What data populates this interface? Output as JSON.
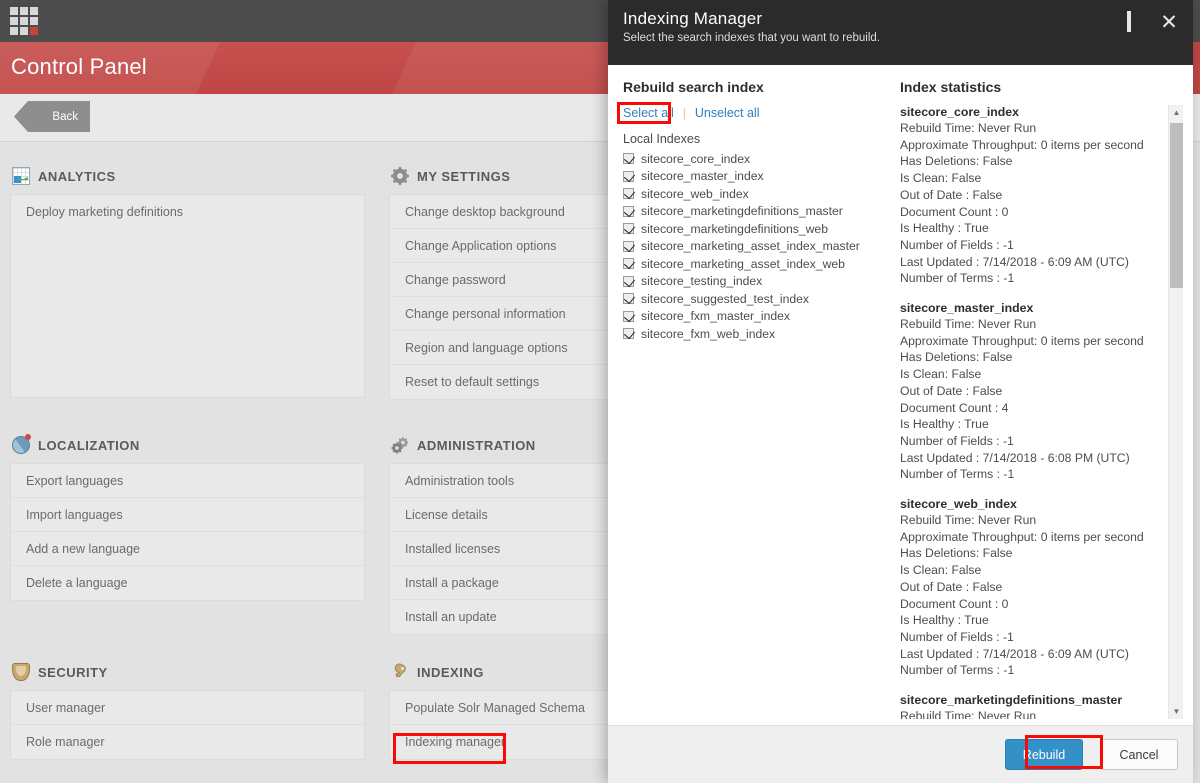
{
  "app": {
    "logo_name": "sitecore-grid-logo",
    "banner_title": "Control Panel",
    "back_label": "Back",
    "accent_red": "#bf4644",
    "topbar_bg": "#4c4c4c"
  },
  "control_panel": {
    "sections": [
      {
        "id": "analytics",
        "title": "ANALYTICS",
        "icon": "analytics-chart-icon",
        "column": 1,
        "items": [
          "Deploy marketing definitions"
        ]
      },
      {
        "id": "my-settings",
        "title": "MY SETTINGS",
        "icon": "gear-icon",
        "column": 2,
        "items": [
          "Change desktop background",
          "Change Application options",
          "Change password",
          "Change personal information",
          "Region and language options",
          "Reset to default settings"
        ]
      },
      {
        "id": "localization",
        "title": "LOCALIZATION",
        "icon": "globe-pin-icon",
        "column": 1,
        "items": [
          "Export languages",
          "Import languages",
          "Add a new language",
          "Delete a language"
        ]
      },
      {
        "id": "administration",
        "title": "ADMINISTRATION",
        "icon": "gears-icon",
        "column": 2,
        "items": [
          "Administration tools",
          "License details",
          "Installed licenses",
          "Install a package",
          "Install an update"
        ]
      },
      {
        "id": "security",
        "title": "SECURITY",
        "icon": "shield-icon",
        "column": 1,
        "items": [
          "User manager",
          "Role manager"
        ]
      },
      {
        "id": "indexing",
        "title": "INDEXING",
        "icon": "key-icon",
        "column": 2,
        "items": [
          "Populate Solr Managed Schema",
          "Indexing manager"
        ],
        "highlighted_item": "Indexing manager"
      }
    ]
  },
  "dialog": {
    "title": "Indexing Manager",
    "subtitle": "Select the search indexes that you want to rebuild.",
    "window_controls": {
      "maximize": "maximize-icon",
      "close": "close-icon"
    },
    "left": {
      "heading": "Rebuild search index",
      "select_all": "Select all",
      "unselect_all": "Unselect all",
      "separator": "|",
      "group_label": "Local Indexes",
      "indexes": [
        {
          "name": "sitecore_core_index",
          "checked": true
        },
        {
          "name": "sitecore_master_index",
          "checked": true
        },
        {
          "name": "sitecore_web_index",
          "checked": true
        },
        {
          "name": "sitecore_marketingdefinitions_master",
          "checked": true
        },
        {
          "name": "sitecore_marketingdefinitions_web",
          "checked": true
        },
        {
          "name": "sitecore_marketing_asset_index_master",
          "checked": true
        },
        {
          "name": "sitecore_marketing_asset_index_web",
          "checked": true
        },
        {
          "name": "sitecore_testing_index",
          "checked": true
        },
        {
          "name": "sitecore_suggested_test_index",
          "checked": true
        },
        {
          "name": "sitecore_fxm_master_index",
          "checked": true
        },
        {
          "name": "sitecore_fxm_web_index",
          "checked": true
        }
      ]
    },
    "right": {
      "heading": "Index statistics",
      "blocks": [
        {
          "name": "sitecore_core_index",
          "lines": [
            "Rebuild Time: Never Run",
            "Approximate Throughput: 0 items per second",
            "Has Deletions: False",
            "Is Clean: False",
            "Out of Date : False",
            "Document Count : 0",
            "Is Healthy : True",
            "Number of Fields : -1",
            "Last Updated : 7/14/2018 - 6:09 AM (UTC)",
            "Number of Terms : -1"
          ]
        },
        {
          "name": "sitecore_master_index",
          "lines": [
            "Rebuild Time: Never Run",
            "Approximate Throughput: 0 items per second",
            "Has Deletions: False",
            "Is Clean: False",
            "Out of Date : False",
            "Document Count : 4",
            "Is Healthy : True",
            "Number of Fields : -1",
            "Last Updated : 7/14/2018 - 6:08 PM (UTC)",
            "Number of Terms : -1"
          ]
        },
        {
          "name": "sitecore_web_index",
          "lines": [
            "Rebuild Time: Never Run",
            "Approximate Throughput: 0 items per second",
            "Has Deletions: False",
            "Is Clean: False",
            "Out of Date : False",
            "Document Count : 0",
            "Is Healthy : True",
            "Number of Fields : -1",
            "Last Updated : 7/14/2018 - 6:09 AM (UTC)",
            "Number of Terms : -1"
          ]
        },
        {
          "name": "sitecore_marketingdefinitions_master",
          "lines": [
            "Rebuild Time: Never Run"
          ]
        }
      ],
      "scrollbar": {
        "up": "scroll-up-arrow-icon",
        "down": "scroll-down-arrow-icon"
      }
    },
    "footer": {
      "rebuild_label": "Rebuild",
      "cancel_label": "Cancel",
      "primary_color": "#3491c8"
    }
  },
  "annotations": {
    "highlight_color": "#fb0808",
    "boxes": [
      "select-all-link",
      "indexing-manager-item",
      "rebuild-button"
    ]
  }
}
